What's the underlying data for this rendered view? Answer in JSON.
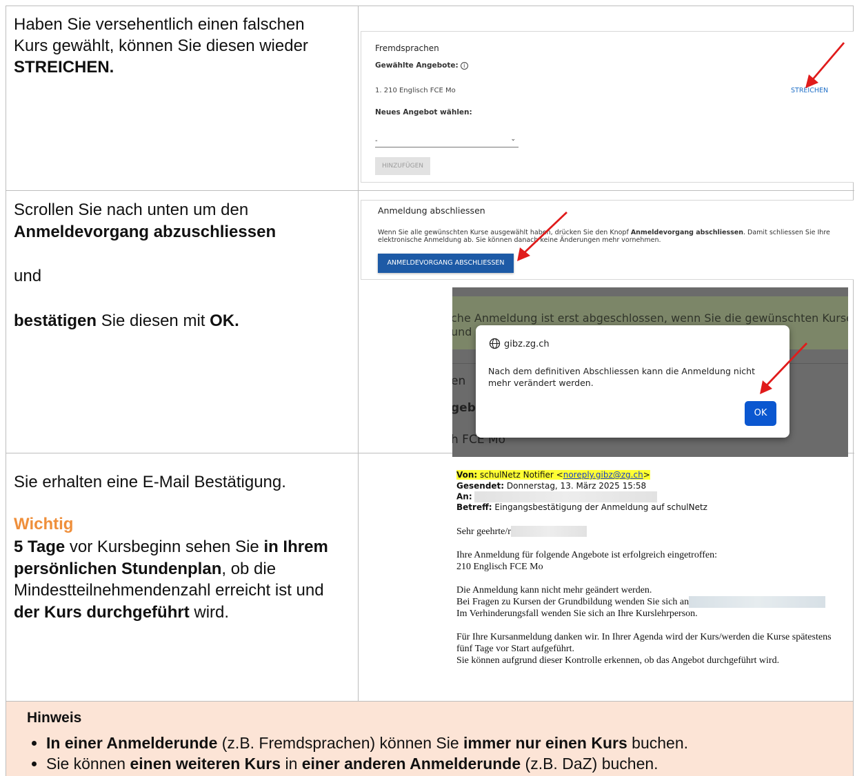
{
  "step1": {
    "text_a": "Haben Sie versehentlich einen falschen Kurs gewählt, können Sie diesen wieder ",
    "text_b": "STREICHEN."
  },
  "panel1": {
    "title": "Fremdsprachen",
    "selected_label": "Gewählte Angebote:",
    "info_icon": "i",
    "item": "1. 210 Englisch FCE Mo",
    "delete_link": "STREICHEN",
    "new_label": "Neues Angebot wählen:",
    "select_value": "-",
    "add_button": "HINZUFÜGEN"
  },
  "step2": {
    "line1": "Scrollen Sie nach unten um den",
    "line2": "Anmeldevorgang abzuschliessen",
    "line3": "und",
    "line4a": "bestätigen",
    "line4b": " Sie diesen mit ",
    "line4c": "OK."
  },
  "panel2": {
    "title": "Anmeldung abschliessen",
    "desc_a": "Wenn Sie alle gewünschten Kurse ausgewählt haben, drücken Sie den Knopf ",
    "desc_b": "Anmeldevorgang abschliessen",
    "desc_c": ". Damit schliessen Sie Ihre elektronische Anmeldung ab. Sie können danach keine Änderungen mehr vornehmen.",
    "button": "ANMELDEVORGANG ABSCHLIESSEN"
  },
  "panel3": {
    "bg_text1": "che Anmeldung ist erst abgeschlossen, wenn Sie die gewünschten Kurse ausgewählt,",
    "bg_text2": "und",
    "bg_g1": "en",
    "bg_g2": "gebo",
    "bg_g3": "h FCE Mo",
    "dialog_host": "gibz.zg.ch",
    "dialog_message": "Nach dem definitiven Abschliessen kann die Anmeldung nicht mehr verändert werden.",
    "ok_button": "OK"
  },
  "step3": {
    "line1": "Sie erhalten eine E-Mail Bestätigung.",
    "important": "Wichtig",
    "p1": "5 Tage",
    "p2": " vor Kursbeginn sehen Sie ",
    "p3": "in Ihrem persönlichen Stundenplan",
    "p4": ", ob die Mindestteilnehmendenzahl erreicht ist und ",
    "p5": "der Kurs durchgeführt",
    "p6": " wird."
  },
  "email": {
    "from_label": "Von:",
    "from_name": " schulNetz Notifier <",
    "from_addr": "noreply.gibz@zg.ch",
    "from_end": ">",
    "sent_label": "Gesendet:",
    "sent_value": " Donnerstag, 13. März 2025 15:58",
    "to_label": "An:",
    "subject_label": "Betreff:",
    "subject_value": " Eingangsbestätigung der Anmeldung auf schulNetz",
    "greeting": "Sehr geehrte/r",
    "body1": "Ihre Anmeldung für folgende Angebote ist erfolgreich eingetroffen:",
    "body2": "210 Englisch FCE Mo",
    "body3": "Die Anmeldung kann nicht mehr geändert werden.",
    "body4": "Bei Fragen zu Kursen der Grundbildung wenden Sie sich an",
    "body5": "Im Verhinderungsfall wenden Sie sich an Ihre Kurslehrperson.",
    "body6": "Für Ihre Kursanmeldung danken wir. In Ihrer Agenda wird der Kurs/werden die Kurse spätestens fünf Tage vor Start aufgeführt.",
    "body7": "Sie können aufgrund dieser Kontrolle erkennen, ob das Angebot durchgeführt wird."
  },
  "note": {
    "heading": "Hinweis",
    "b1a": "In einer Anmelderunde",
    "b1b": " (z.B. Fremdsprachen) können Sie ",
    "b1c": "immer nur einen Kurs",
    "b1d": " buchen.",
    "b2a": "Sie können ",
    "b2b": "einen weiteren Kurs",
    "b2c": " in ",
    "b2d": "einer anderen Anmelderunde",
    "b2e": " (z.B. DaZ) buchen."
  },
  "colors": {
    "arrow": "#e01b1b",
    "accent_orange": "#ef8f3b",
    "note_bg": "#fce4d6",
    "link_blue": "#1e6fc7",
    "primary_button": "#1d5aa6",
    "ok_button": "#0b57d0"
  }
}
